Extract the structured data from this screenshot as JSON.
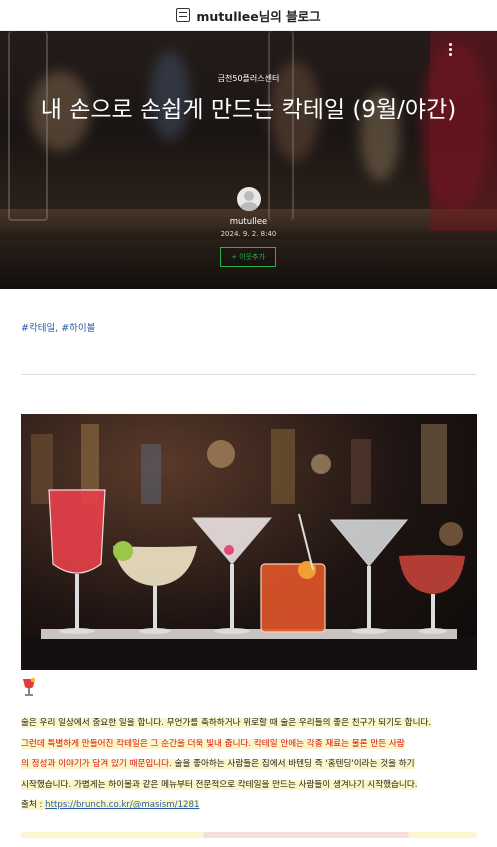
{
  "header": {
    "blog_title": "mutullee님의 블로그",
    "blog_icon": "blog-book-icon"
  },
  "hero": {
    "category": "금천50플러스센터",
    "title": "내 손으로 손쉽게 만드는 칵테일         (9월/야간)",
    "author": "mutullee",
    "date": "2024. 9. 2. 8:40",
    "neighbor_button": "+ 이웃추가",
    "more_icon": "more-vertical-icon"
  },
  "tags": "#칵테일, #하이볼",
  "body": {
    "line1": "술은 우리 일상에서 중요한 일을 합니다. 무언가를 축하하거나 위로할 때 술은 우리들의 좋은 친구가 되기도 합니다.",
    "line2_red": "그런데 특별하게 만들어진 칵테일은 그 순간을 더욱 빛내 줍니다. 칵테일 안에는 각종 재료는 물론 만든 사람",
    "line3_red": "의 정성과 이야기가 담겨 있기 때문입니다. ",
    "line3_black": "술을 좋아하는 사람들은 집에서 바텐딩 즉 '홈텐딩'이라는 것을 하기",
    "line4": "시작했습니다. 가볍게는 하이볼과 같은 메뉴부터 전문적으로 칵테일을 만드는 사람들이 생겨나기 시작했습니다.",
    "source_label": "출처 : ",
    "source_link": "https://brunch.co.kr/@masism/1281"
  },
  "colors": {
    "accent_green": "#22b54a",
    "link_blue": "#2a5ea8",
    "highlight": "#fbf6c8",
    "red_text": "#dd1111"
  }
}
